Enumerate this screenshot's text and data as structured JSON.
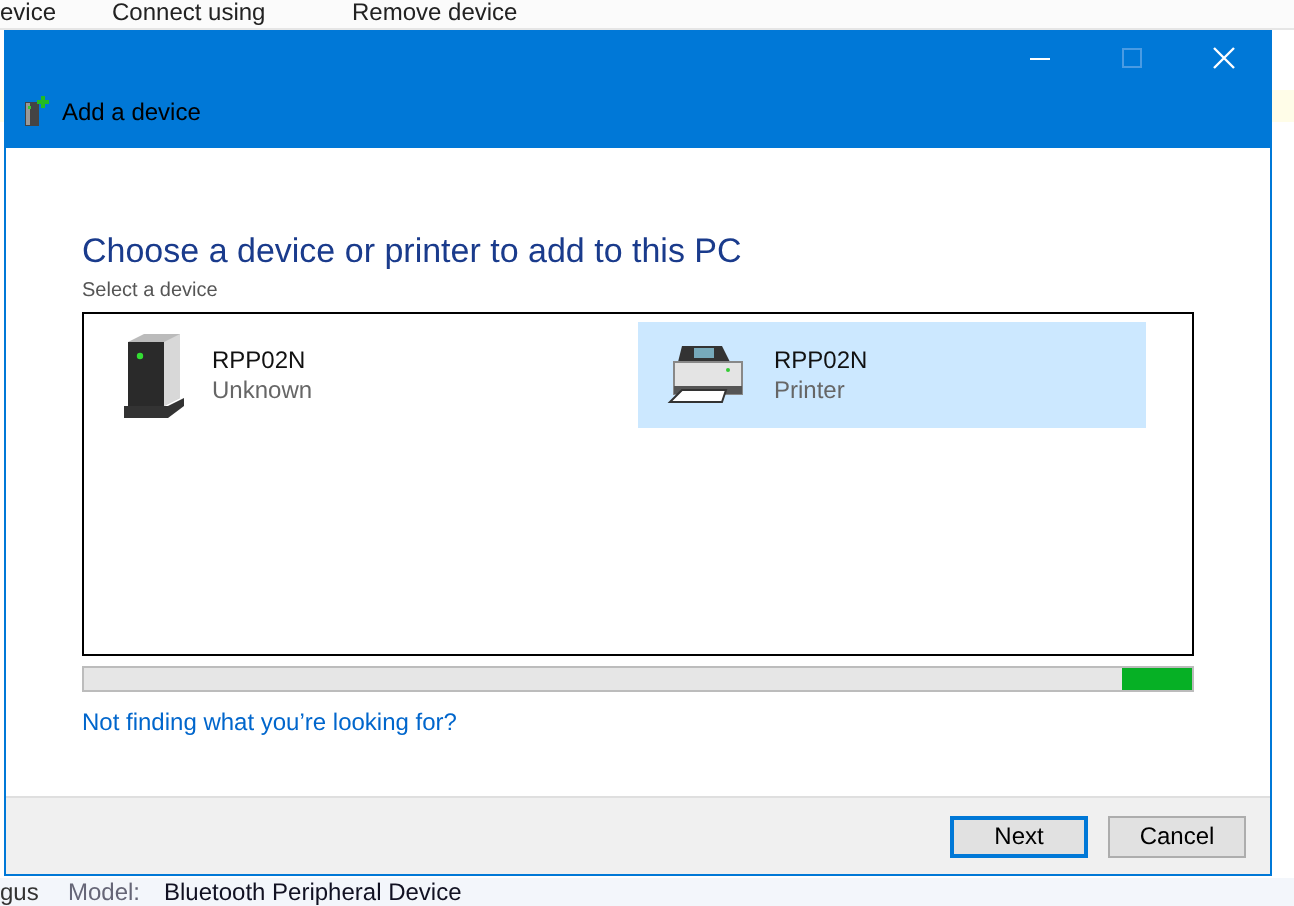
{
  "background_window": {
    "toolbar": [
      "evice",
      "Connect using",
      "Remove device"
    ],
    "details": [
      {
        "label": "gus"
      },
      {
        "label": "Model:",
        "value": "Bluetooth Peripheral Device"
      }
    ]
  },
  "window": {
    "title": "Add a device"
  },
  "heading": "Choose a device or printer to add to this PC",
  "subheading": "Select a device",
  "devices": [
    {
      "name": "RPP02N",
      "type": "Unknown",
      "kind": "tower",
      "selected": false
    },
    {
      "name": "RPP02N",
      "type": "Printer",
      "kind": "printer",
      "selected": true
    }
  ],
  "progress": {
    "indeterminate": true
  },
  "link": "Not finding what you’re looking for?",
  "buttons": [
    {
      "label": "Next",
      "default": true
    },
    {
      "label": "Cancel",
      "default": false
    }
  ]
}
